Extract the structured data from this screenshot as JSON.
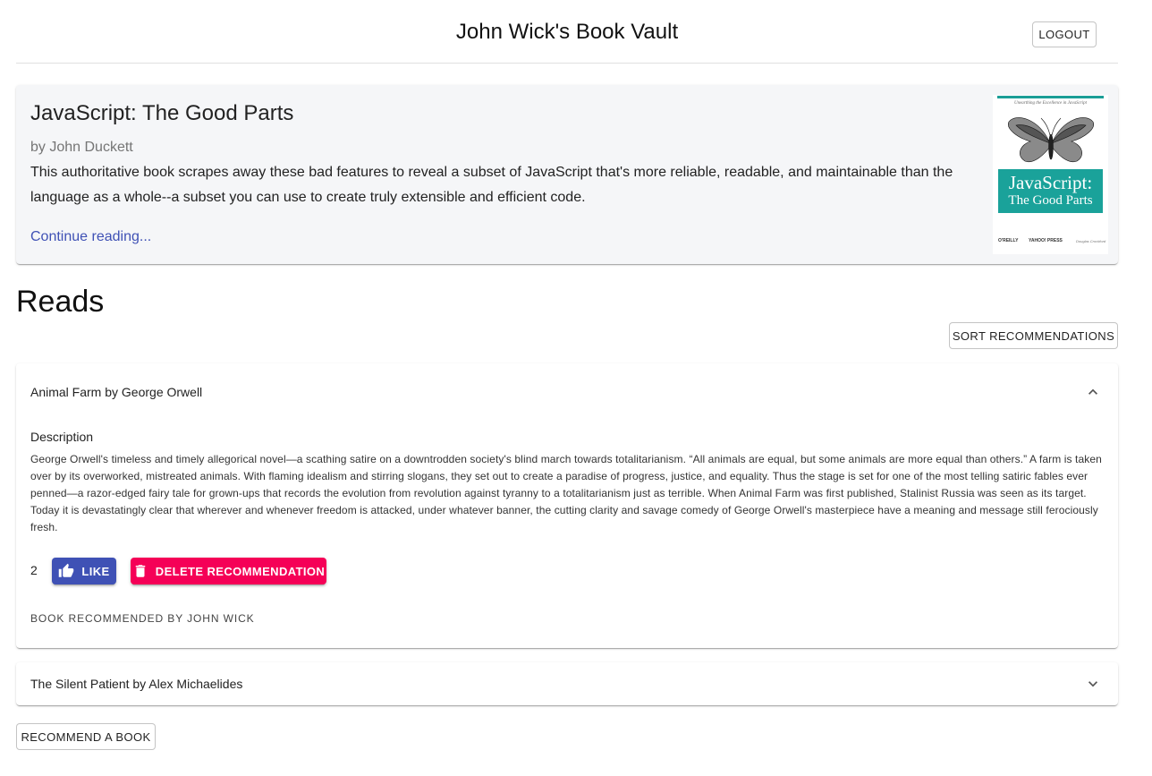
{
  "header": {
    "title": "John Wick's Book Vault",
    "logout_label": "LOGOUT"
  },
  "featured": {
    "title": "JavaScript: The Good Parts",
    "author": "by John Duckett",
    "description": "This authoritative book scrapes away these bad features to reveal a subset of JavaScript that's more reliable, readable, and maintainable than the language as a whole--a subset you can use to create truly extensible and efficient code.",
    "link_label": "Continue reading...",
    "cover": {
      "tagline": "Unearthing the Excellence in JavaScript",
      "title_line1": "JavaScript:",
      "title_line2": "The Good Parts",
      "publisher1": "O'REILLY",
      "publisher2": "YAHOO! PRESS",
      "cover_author": "Douglas Crockford",
      "accent_color": "#1aa29a"
    }
  },
  "reads": {
    "heading": "Reads",
    "sort_label": "SORT RECOMMENDATIONS",
    "items": [
      {
        "title": "Animal Farm by George Orwell",
        "expanded": true,
        "description_label": "Description",
        "description": "George Orwell's timeless and timely allegorical novel—a scathing satire on a downtrodden society's blind march towards totalitarianism. “All animals are equal, but some animals are more equal than others.” A farm is taken over by its overworked, mistreated animals. With flaming idealism and stirring slogans, they set out to create a paradise of progress, justice, and equality. Thus the stage is set for one of the most telling satiric fables ever penned—a razor-edged fairy tale for grown-ups that records the evolution from revolution against tyranny to a totalitarianism just as terrible. When Animal Farm was first published, Stalinist Russia was seen as its target. Today it is devastatingly clear that wherever and whenever freedom is attacked, under whatever banner, the cutting clarity and savage comedy of George Orwell's masterpiece have a meaning and message still ferociously fresh.",
        "likes": "2",
        "like_label": "LIKE",
        "delete_label": "DELETE RECOMMENDATION",
        "recommended_by": "BOOK RECOMMENDED BY JOHN WICK"
      },
      {
        "title": "The Silent Patient by Alex Michaelides",
        "expanded": false
      }
    ],
    "recommend_label": "RECOMMEND A BOOK"
  },
  "colors": {
    "primary": "#3f51b5",
    "secondary": "#f50057"
  },
  "icons": {
    "like": "thumb-up-icon",
    "delete": "trash-icon",
    "expand": "chevron-down-icon",
    "collapse": "chevron-up-icon"
  }
}
